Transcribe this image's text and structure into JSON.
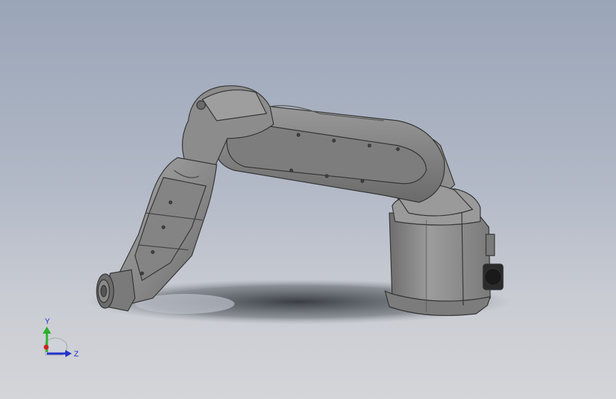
{
  "viewport": {
    "background_top": "#9aa5b8",
    "background_bottom": "#d4d5d9",
    "part_color": "#8c8c8c",
    "edge_color": "#3a3a3a"
  },
  "triad": {
    "y_label": "Y",
    "z_label": "Z",
    "y_color": "#2bb02b",
    "z_color": "#2233cc",
    "x_color": "#cc2222"
  },
  "model": {
    "icon": "robot-arm-model"
  }
}
